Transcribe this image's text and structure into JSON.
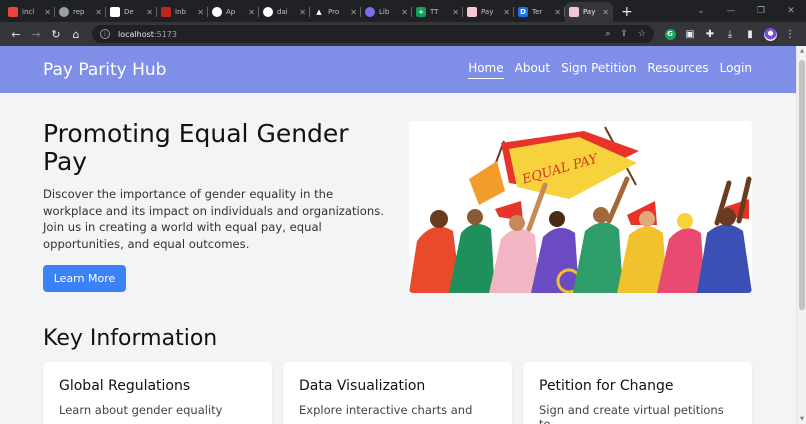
{
  "browser": {
    "tabs": [
      {
        "title": "incl",
        "color": "#e8453c"
      },
      {
        "title": "rep",
        "color": "#9aa0a6"
      },
      {
        "title": "De",
        "color": "#ffffff"
      },
      {
        "title": "Inb",
        "color": "#c5221f"
      },
      {
        "title": "Ap",
        "color": "#ffffff"
      },
      {
        "title": "dai",
        "color": "#ffffff"
      },
      {
        "title": "Pro",
        "color": "#ffffff"
      },
      {
        "title": "Lib",
        "color": "#7c6cf0"
      },
      {
        "title": "TT",
        "color": "#0f9d58"
      },
      {
        "title": "Pay",
        "color": "#f4c7d2"
      },
      {
        "title": "Ter",
        "color": "#1a73e8"
      },
      {
        "title": "Pay",
        "color": "#f4c7d2"
      }
    ],
    "url_host": "localhost",
    "url_port": ":5173"
  },
  "site": {
    "brand": "Pay Parity Hub",
    "nav": [
      "Home",
      "About",
      "Sign Petition",
      "Resources",
      "Login"
    ]
  },
  "hero": {
    "title": "Promoting Equal Gender Pay",
    "description": "Discover the importance of gender equality in the workplace and its impact on individuals and organizations. Join us in creating a world with equal pay, equal opportunities, and equal outcomes.",
    "button": "Learn More",
    "banner_text": "EQUAL PAY"
  },
  "key_info": {
    "title": "Key Information",
    "cards": [
      {
        "title": "Global Regulations",
        "text": "Learn about gender equality"
      },
      {
        "title": "Data Visualization",
        "text": "Explore interactive charts and"
      },
      {
        "title": "Petition for Change",
        "text": "Sign and create virtual petitions to"
      }
    ]
  }
}
